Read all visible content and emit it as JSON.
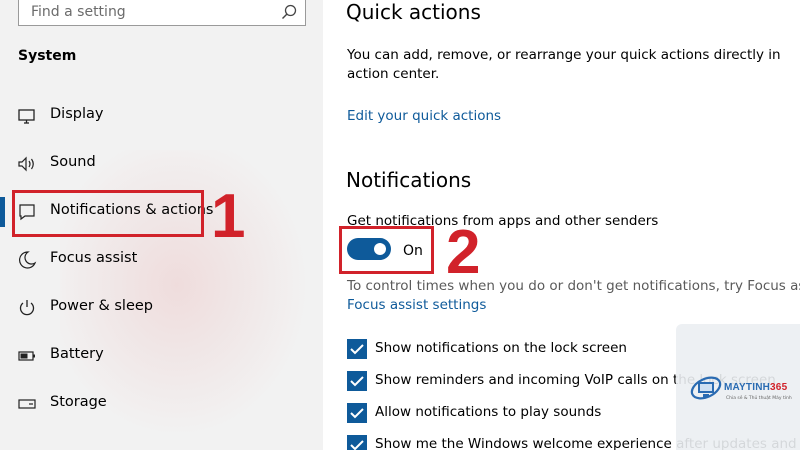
{
  "sidebar": {
    "search_placeholder": "Find a setting",
    "section_title": "System",
    "items": [
      {
        "label": "Display",
        "icon": "monitor-icon"
      },
      {
        "label": "Sound",
        "icon": "speaker-icon"
      },
      {
        "label": "Notifications & actions",
        "icon": "message-icon",
        "selected": true
      },
      {
        "label": "Focus assist",
        "icon": "moon-icon"
      },
      {
        "label": "Power & sleep",
        "icon": "power-icon"
      },
      {
        "label": "Battery",
        "icon": "battery-icon"
      },
      {
        "label": "Storage",
        "icon": "storage-icon"
      }
    ]
  },
  "annotations": {
    "step1": "1",
    "step2": "2",
    "color": "#d1222a"
  },
  "content": {
    "quick_actions_title": "Quick actions",
    "quick_actions_desc": "You can add, remove, or rearrange your quick actions directly in action center.",
    "edit_quick_actions_link": "Edit your quick actions",
    "notifications_title": "Notifications",
    "get_notifications_label": "Get notifications from apps and other senders",
    "toggle_state": "On",
    "focus_hint": "To control times when you do or don't get notifications, try Focus assist.",
    "focus_assist_link": "Focus assist settings",
    "checkboxes": [
      {
        "label": "Show notifications on the lock screen",
        "checked": true
      },
      {
        "label": "Show reminders and incoming VoIP calls on the lock screen",
        "checked": true
      },
      {
        "label": "Allow notifications to play sounds",
        "checked": true
      },
      {
        "label": "Show me the Windows welcome experience after updates and",
        "checked": true
      }
    ]
  },
  "watermark": {
    "brand_name": "MAYTINH",
    "brand_number": "365",
    "tagline": "Chia sẻ & Thủ thuật Máy tính"
  },
  "colors": {
    "accent": "#0e5a9a",
    "link": "#0e5a9a",
    "annotation": "#d1222a",
    "sidebar_bg": "#f2f2f2"
  }
}
